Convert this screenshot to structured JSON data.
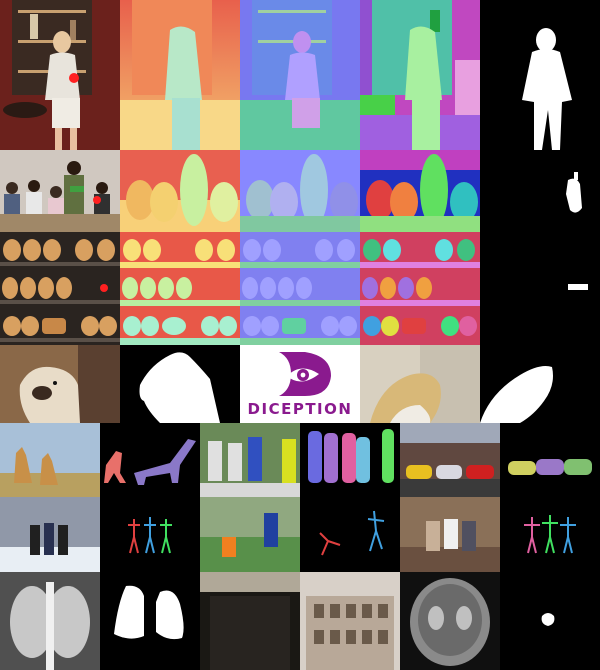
{
  "logo": {
    "text": "DICEPTION",
    "color": "#8a1a8e"
  },
  "colors": {
    "depth_warm": "#f0a050",
    "depth_cool": "#c8e8b0",
    "normal_blue": "#8080ff",
    "seg_purple": "#a070e0",
    "point_marker": "#ff2020"
  },
  "icons": {
    "logo_mark": "eye-icon"
  }
}
